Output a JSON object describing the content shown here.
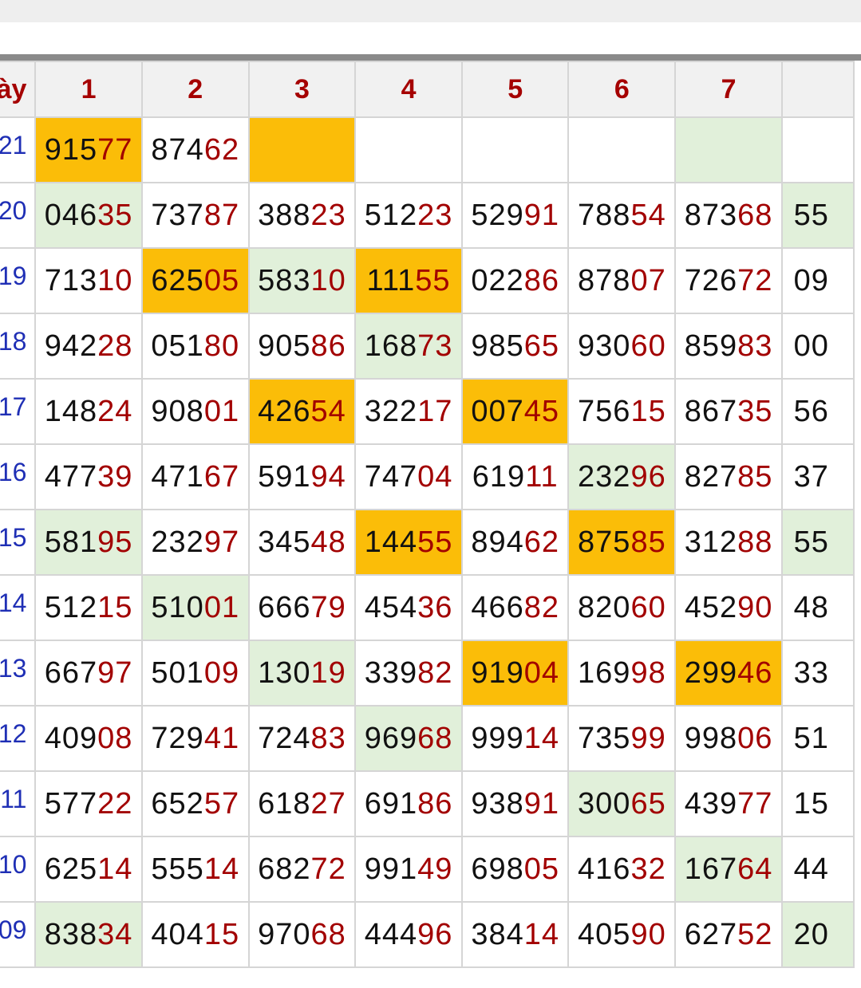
{
  "header": {
    "day_label": "ày",
    "columns": [
      "1",
      "2",
      "3",
      "4",
      "5",
      "6",
      "7",
      ""
    ]
  },
  "colors": {
    "highlight_orange": "#fbbd08",
    "highlight_green": "#e1f0da",
    "suffix_digits": "#a20000",
    "date_text": "#1f2fb5",
    "header_text": "#a50000"
  },
  "rows": [
    {
      "day": "21",
      "cells": [
        {
          "prefix": "915",
          "suffix": "77",
          "hl": "orange"
        },
        {
          "prefix": "874",
          "suffix": "62",
          "hl": ""
        },
        {
          "prefix": "",
          "suffix": "",
          "hl": "orange"
        },
        {
          "prefix": "",
          "suffix": "",
          "hl": ""
        },
        {
          "prefix": "",
          "suffix": "",
          "hl": ""
        },
        {
          "prefix": "",
          "suffix": "",
          "hl": ""
        },
        {
          "prefix": "",
          "suffix": "",
          "hl": "green"
        },
        {
          "prefix": "",
          "suffix": "",
          "hl": ""
        }
      ]
    },
    {
      "day": "20",
      "cells": [
        {
          "prefix": "046",
          "suffix": "35",
          "hl": "green"
        },
        {
          "prefix": "737",
          "suffix": "87",
          "hl": ""
        },
        {
          "prefix": "388",
          "suffix": "23",
          "hl": ""
        },
        {
          "prefix": "512",
          "suffix": "23",
          "hl": ""
        },
        {
          "prefix": "529",
          "suffix": "91",
          "hl": ""
        },
        {
          "prefix": "788",
          "suffix": "54",
          "hl": ""
        },
        {
          "prefix": "873",
          "suffix": "68",
          "hl": ""
        },
        {
          "prefix": "55",
          "suffix": "",
          "hl": "green"
        }
      ]
    },
    {
      "day": "19",
      "cells": [
        {
          "prefix": "713",
          "suffix": "10",
          "hl": ""
        },
        {
          "prefix": "625",
          "suffix": "05",
          "hl": "orange"
        },
        {
          "prefix": "583",
          "suffix": "10",
          "hl": "green"
        },
        {
          "prefix": "111",
          "suffix": "55",
          "hl": "orange"
        },
        {
          "prefix": "022",
          "suffix": "86",
          "hl": ""
        },
        {
          "prefix": "878",
          "suffix": "07",
          "hl": ""
        },
        {
          "prefix": "726",
          "suffix": "72",
          "hl": ""
        },
        {
          "prefix": "09",
          "suffix": "",
          "hl": ""
        }
      ]
    },
    {
      "day": "18",
      "cells": [
        {
          "prefix": "942",
          "suffix": "28",
          "hl": ""
        },
        {
          "prefix": "051",
          "suffix": "80",
          "hl": ""
        },
        {
          "prefix": "905",
          "suffix": "86",
          "hl": ""
        },
        {
          "prefix": "168",
          "suffix": "73",
          "hl": "green"
        },
        {
          "prefix": "985",
          "suffix": "65",
          "hl": ""
        },
        {
          "prefix": "930",
          "suffix": "60",
          "hl": ""
        },
        {
          "prefix": "859",
          "suffix": "83",
          "hl": ""
        },
        {
          "prefix": "00",
          "suffix": "",
          "hl": ""
        }
      ]
    },
    {
      "day": "17",
      "cells": [
        {
          "prefix": "148",
          "suffix": "24",
          "hl": ""
        },
        {
          "prefix": "908",
          "suffix": "01",
          "hl": ""
        },
        {
          "prefix": "426",
          "suffix": "54",
          "hl": "orange"
        },
        {
          "prefix": "322",
          "suffix": "17",
          "hl": ""
        },
        {
          "prefix": "007",
          "suffix": "45",
          "hl": "orange"
        },
        {
          "prefix": "756",
          "suffix": "15",
          "hl": ""
        },
        {
          "prefix": "867",
          "suffix": "35",
          "hl": ""
        },
        {
          "prefix": "56",
          "suffix": "",
          "hl": ""
        }
      ]
    },
    {
      "day": "16",
      "cells": [
        {
          "prefix": "477",
          "suffix": "39",
          "hl": ""
        },
        {
          "prefix": "471",
          "suffix": "67",
          "hl": ""
        },
        {
          "prefix": "591",
          "suffix": "94",
          "hl": ""
        },
        {
          "prefix": "747",
          "suffix": "04",
          "hl": ""
        },
        {
          "prefix": "619",
          "suffix": "11",
          "hl": ""
        },
        {
          "prefix": "232",
          "suffix": "96",
          "hl": "green"
        },
        {
          "prefix": "827",
          "suffix": "85",
          "hl": ""
        },
        {
          "prefix": "37",
          "suffix": "",
          "hl": ""
        }
      ]
    },
    {
      "day": "15",
      "cells": [
        {
          "prefix": "581",
          "suffix": "95",
          "hl": "green"
        },
        {
          "prefix": "232",
          "suffix": "97",
          "hl": ""
        },
        {
          "prefix": "345",
          "suffix": "48",
          "hl": ""
        },
        {
          "prefix": "144",
          "suffix": "55",
          "hl": "orange"
        },
        {
          "prefix": "894",
          "suffix": "62",
          "hl": ""
        },
        {
          "prefix": "875",
          "suffix": "85",
          "hl": "orange"
        },
        {
          "prefix": "312",
          "suffix": "88",
          "hl": ""
        },
        {
          "prefix": "55",
          "suffix": "",
          "hl": "green"
        }
      ]
    },
    {
      "day": "14",
      "cells": [
        {
          "prefix": "512",
          "suffix": "15",
          "hl": ""
        },
        {
          "prefix": "510",
          "suffix": "01",
          "hl": "green"
        },
        {
          "prefix": "666",
          "suffix": "79",
          "hl": ""
        },
        {
          "prefix": "454",
          "suffix": "36",
          "hl": ""
        },
        {
          "prefix": "466",
          "suffix": "82",
          "hl": ""
        },
        {
          "prefix": "820",
          "suffix": "60",
          "hl": ""
        },
        {
          "prefix": "452",
          "suffix": "90",
          "hl": ""
        },
        {
          "prefix": "48",
          "suffix": "",
          "hl": ""
        }
      ]
    },
    {
      "day": "13",
      "cells": [
        {
          "prefix": "667",
          "suffix": "97",
          "hl": ""
        },
        {
          "prefix": "501",
          "suffix": "09",
          "hl": ""
        },
        {
          "prefix": "130",
          "suffix": "19",
          "hl": "green"
        },
        {
          "prefix": "339",
          "suffix": "82",
          "hl": ""
        },
        {
          "prefix": "919",
          "suffix": "04",
          "hl": "orange"
        },
        {
          "prefix": "169",
          "suffix": "98",
          "hl": ""
        },
        {
          "prefix": "299",
          "suffix": "46",
          "hl": "orange"
        },
        {
          "prefix": "33",
          "suffix": "",
          "hl": ""
        }
      ]
    },
    {
      "day": "12",
      "cells": [
        {
          "prefix": "409",
          "suffix": "08",
          "hl": ""
        },
        {
          "prefix": "729",
          "suffix": "41",
          "hl": ""
        },
        {
          "prefix": "724",
          "suffix": "83",
          "hl": ""
        },
        {
          "prefix": "969",
          "suffix": "68",
          "hl": "green"
        },
        {
          "prefix": "999",
          "suffix": "14",
          "hl": ""
        },
        {
          "prefix": "735",
          "suffix": "99",
          "hl": ""
        },
        {
          "prefix": "998",
          "suffix": "06",
          "hl": ""
        },
        {
          "prefix": "51",
          "suffix": "",
          "hl": ""
        }
      ]
    },
    {
      "day": "11",
      "cells": [
        {
          "prefix": "577",
          "suffix": "22",
          "hl": ""
        },
        {
          "prefix": "652",
          "suffix": "57",
          "hl": ""
        },
        {
          "prefix": "618",
          "suffix": "27",
          "hl": ""
        },
        {
          "prefix": "691",
          "suffix": "86",
          "hl": ""
        },
        {
          "prefix": "938",
          "suffix": "91",
          "hl": ""
        },
        {
          "prefix": "300",
          "suffix": "65",
          "hl": "green"
        },
        {
          "prefix": "439",
          "suffix": "77",
          "hl": ""
        },
        {
          "prefix": "15",
          "suffix": "",
          "hl": ""
        }
      ]
    },
    {
      "day": "10",
      "cells": [
        {
          "prefix": "625",
          "suffix": "14",
          "hl": ""
        },
        {
          "prefix": "555",
          "suffix": "14",
          "hl": ""
        },
        {
          "prefix": "682",
          "suffix": "72",
          "hl": ""
        },
        {
          "prefix": "991",
          "suffix": "49",
          "hl": ""
        },
        {
          "prefix": "698",
          "suffix": "05",
          "hl": ""
        },
        {
          "prefix": "416",
          "suffix": "32",
          "hl": ""
        },
        {
          "prefix": "167",
          "suffix": "64",
          "hl": "green"
        },
        {
          "prefix": "44",
          "suffix": "",
          "hl": ""
        }
      ]
    },
    {
      "day": "09",
      "cells": [
        {
          "prefix": "838",
          "suffix": "34",
          "hl": "green"
        },
        {
          "prefix": "404",
          "suffix": "15",
          "hl": ""
        },
        {
          "prefix": "970",
          "suffix": "68",
          "hl": ""
        },
        {
          "prefix": "444",
          "suffix": "96",
          "hl": ""
        },
        {
          "prefix": "384",
          "suffix": "14",
          "hl": ""
        },
        {
          "prefix": "405",
          "suffix": "90",
          "hl": ""
        },
        {
          "prefix": "627",
          "suffix": "52",
          "hl": ""
        },
        {
          "prefix": "20",
          "suffix": "",
          "hl": "green"
        }
      ]
    }
  ]
}
